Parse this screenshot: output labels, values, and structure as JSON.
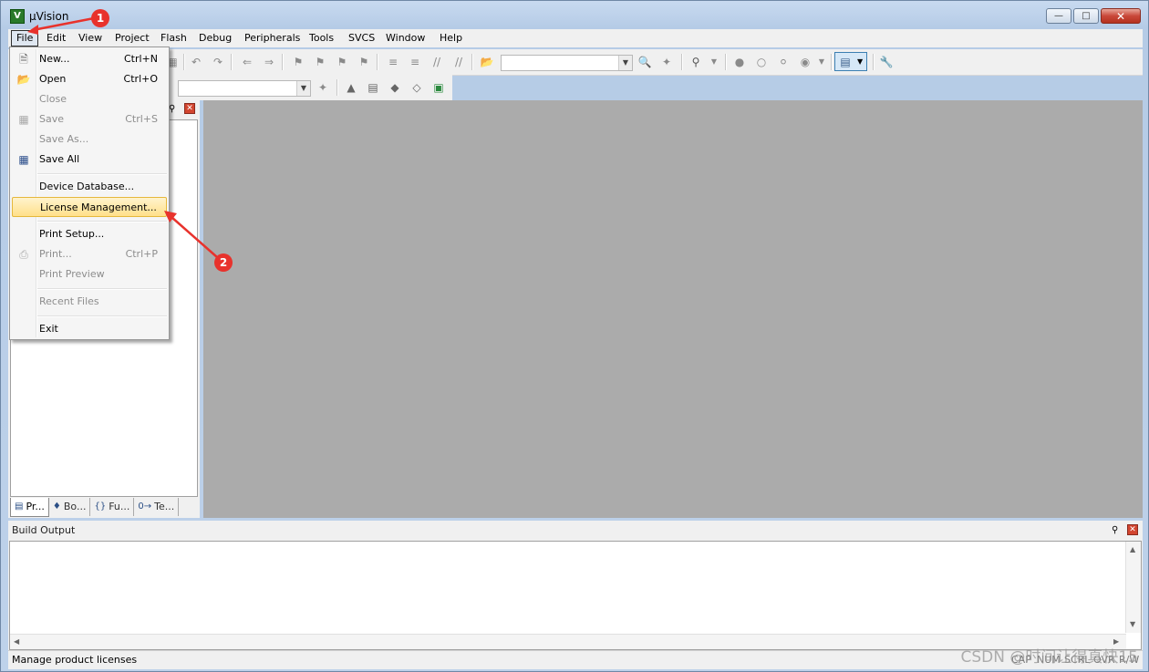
{
  "window": {
    "title": "µVision",
    "app_icon_glyph": "V"
  },
  "menubar": {
    "items": [
      {
        "label": "File",
        "active": true
      },
      {
        "label": "Edit"
      },
      {
        "label": "View"
      },
      {
        "label": "Project"
      },
      {
        "label": "Flash"
      },
      {
        "label": "Debug"
      },
      {
        "label": "Peripherals"
      },
      {
        "label": "Tools"
      },
      {
        "label": "SVCS"
      },
      {
        "label": "Window"
      },
      {
        "label": "Help"
      }
    ]
  },
  "file_menu": {
    "items": [
      {
        "label": "New...",
        "shortcut": "Ctrl+N",
        "icon": "new-file-icon",
        "enabled": true
      },
      {
        "label": "Open",
        "shortcut": "Ctrl+O",
        "icon": "open-folder-icon",
        "enabled": true
      },
      {
        "label": "Close",
        "shortcut": "",
        "icon": "",
        "enabled": false
      },
      {
        "label": "Save",
        "shortcut": "Ctrl+S",
        "icon": "save-icon",
        "enabled": false
      },
      {
        "label": "Save As...",
        "shortcut": "",
        "icon": "",
        "enabled": false
      },
      {
        "label": "Save All",
        "shortcut": "",
        "icon": "save-all-icon",
        "enabled": true
      },
      {
        "label": "Device Database...",
        "shortcut": "",
        "icon": "",
        "enabled": true
      },
      {
        "label": "License Management...",
        "shortcut": "",
        "icon": "",
        "enabled": true,
        "highlighted": true
      },
      {
        "label": "Print Setup...",
        "shortcut": "",
        "icon": "",
        "enabled": true
      },
      {
        "label": "Print...",
        "shortcut": "Ctrl+P",
        "icon": "print-icon",
        "enabled": false
      },
      {
        "label": "Print Preview",
        "shortcut": "",
        "icon": "",
        "enabled": false
      },
      {
        "label": "Recent Files",
        "shortcut": "",
        "icon": "",
        "enabled": false
      },
      {
        "label": "Exit",
        "shortcut": "",
        "icon": "",
        "enabled": true
      }
    ]
  },
  "project_panel": {
    "tabs": [
      {
        "label": "Pr...",
        "icon": "project-icon",
        "active": true
      },
      {
        "label": "Bo...",
        "icon": "books-icon"
      },
      {
        "label": "Fu...",
        "icon": "functions-icon",
        "glyph": "{}"
      },
      {
        "label": "Te...",
        "icon": "templates-icon",
        "glyph": "0→"
      }
    ]
  },
  "build_output": {
    "title": "Build Output"
  },
  "statusbar": {
    "text": "Manage product licenses",
    "indicators": [
      "CAP",
      "NUM",
      "SCRL",
      "OVR",
      "R/W"
    ]
  },
  "annotations": {
    "badge1": "1",
    "badge2": "2",
    "color": "#e8322c"
  },
  "watermark": "CSDN @时间让得真快15"
}
